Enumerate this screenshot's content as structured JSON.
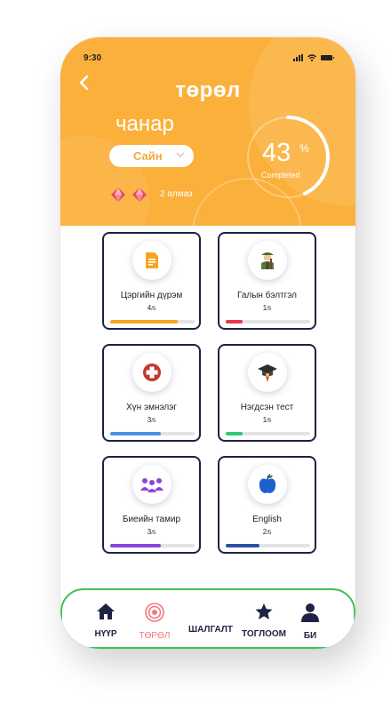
{
  "status": {
    "time": "9:30"
  },
  "header": {
    "title": "төрөл",
    "subtitle": "чанар",
    "dropdown_value": "Сайн",
    "gems_text": "2 алмаз"
  },
  "progress": {
    "value": "43",
    "percent_symbol": "%",
    "label": "Completed",
    "fraction": 0.43
  },
  "categories": [
    {
      "name": "Цэргийн дүрэм",
      "done": "4",
      "total": "/5",
      "ratio": 0.8,
      "color": "#f5a623",
      "icon": "document-icon"
    },
    {
      "name": "Галын бэлтгэл",
      "done": "1",
      "total": "/5",
      "ratio": 0.2,
      "color": "#e8364a",
      "icon": "soldier-icon"
    },
    {
      "name": "Хүн эмнэлэг",
      "done": "3",
      "total": "/5",
      "ratio": 0.6,
      "color": "#4a90e2",
      "icon": "medical-cross-icon"
    },
    {
      "name": "Нэгдсэн тест",
      "done": "1",
      "total": "/5",
      "ratio": 0.2,
      "color": "#2ecc71",
      "icon": "graduation-cap-icon"
    },
    {
      "name": "Биеийн тамир",
      "done": "3",
      "total": "/5",
      "ratio": 0.6,
      "color": "#8e44d9",
      "icon": "group-icon"
    },
    {
      "name": "English",
      "done": "2",
      "total": "/5",
      "ratio": 0.4,
      "color": "#2b4fa8",
      "icon": "apple-icon"
    }
  ],
  "nav": [
    {
      "label": "НҮҮР",
      "icon": "home-icon",
      "active": false
    },
    {
      "label": "ТӨРӨЛ",
      "icon": "target-icon",
      "active": true
    },
    {
      "label": "ШАЛГАЛТ",
      "icon": "",
      "active": false
    },
    {
      "label": "ТОГЛООМ",
      "icon": "star-icon",
      "active": false
    },
    {
      "label": "БИ",
      "icon": "user-icon",
      "active": false
    }
  ],
  "colors": {
    "accent": "#fbb03b",
    "card_border": "#1e2045",
    "nav_border": "#40c057",
    "active_nav": "#f0787c"
  }
}
